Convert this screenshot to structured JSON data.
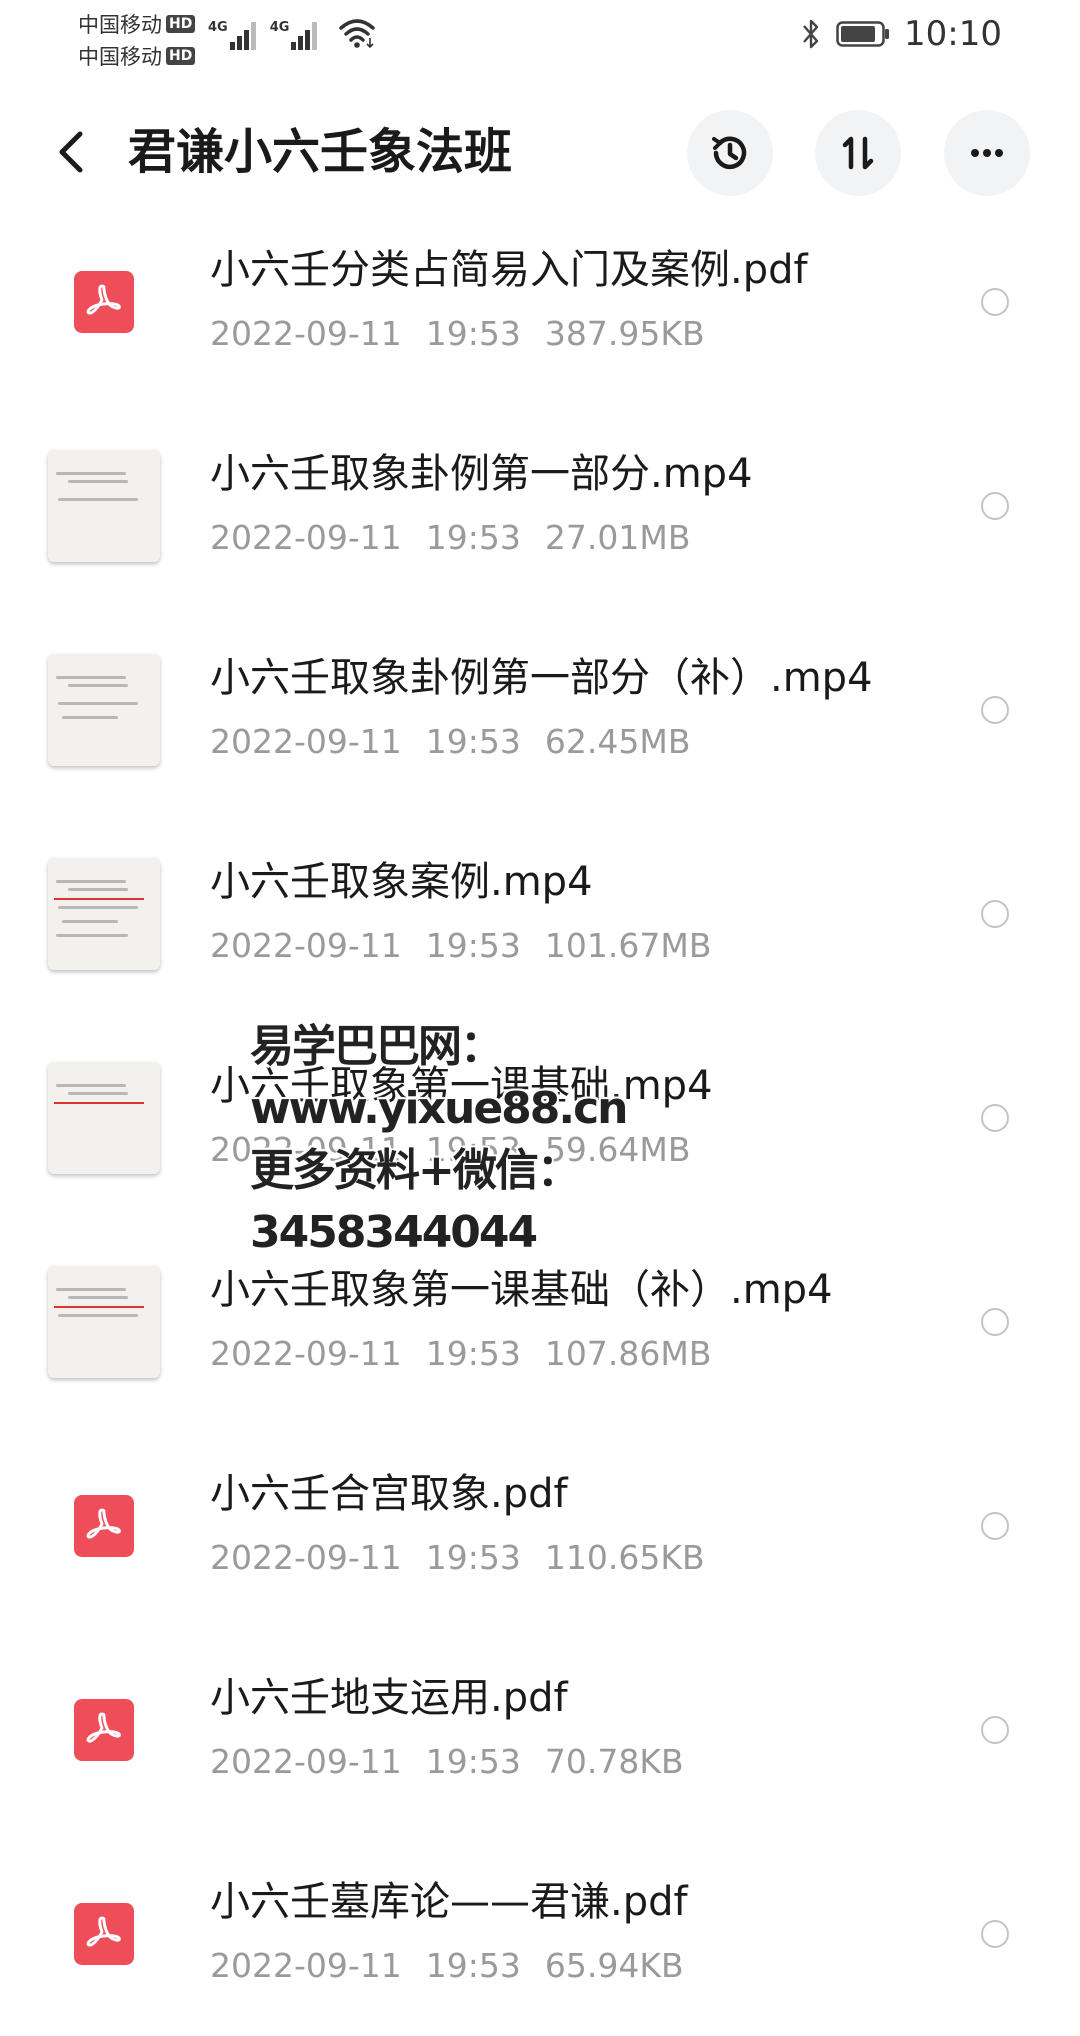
{
  "status_bar": {
    "carrier1": "中国移动",
    "carrier2": "中国移动",
    "hd_label": "HD",
    "signal_label": "4G",
    "time": "10:10"
  },
  "header": {
    "title": "君谦小六壬象法班",
    "back_icon": "chevron-left-icon",
    "history_icon": "clock-history-icon",
    "sort_icon": "sort-icon",
    "more_icon": "more-dots-icon"
  },
  "files": [
    {
      "name": "小六壬分类占简易入门及案例.pdf",
      "date": "2022-09-11",
      "time": "19:53",
      "size": "387.95KB",
      "type": "pdf"
    },
    {
      "name": "小六壬取象卦例第一部分.mp4",
      "date": "2022-09-11",
      "time": "19:53",
      "size": "27.01MB",
      "type": "video"
    },
    {
      "name": "小六壬取象卦例第一部分（补）.mp4",
      "date": "2022-09-11",
      "time": "19:53",
      "size": "62.45MB",
      "type": "video"
    },
    {
      "name": "小六壬取象案例.mp4",
      "date": "2022-09-11",
      "time": "19:53",
      "size": "101.67MB",
      "type": "video"
    },
    {
      "name": "小六壬取象第一课基础.mp4",
      "date": "2022-09-11",
      "time": "19:53",
      "size": "59.64MB",
      "type": "video"
    },
    {
      "name": "小六壬取象第一课基础（补）.mp4",
      "date": "2022-09-11",
      "time": "19:53",
      "size": "107.86MB",
      "type": "video"
    },
    {
      "name": "小六壬合宫取象.pdf",
      "date": "2022-09-11",
      "time": "19:53",
      "size": "110.65KB",
      "type": "pdf"
    },
    {
      "name": "小六壬地支运用.pdf",
      "date": "2022-09-11",
      "time": "19:53",
      "size": "70.78KB",
      "type": "pdf"
    },
    {
      "name": "小六壬墓库论——君谦.pdf",
      "date": "2022-09-11",
      "time": "19:53",
      "size": "65.94KB",
      "type": "pdf"
    }
  ],
  "watermark": {
    "line1": "易学巴巴网：www.yixue88.cn",
    "line2": "更多资料+微信：3458344044"
  },
  "colors": {
    "pdf_red": "#ee4d5a",
    "meta_gray": "#9a9a9a",
    "button_bg": "#f1f3f5"
  }
}
